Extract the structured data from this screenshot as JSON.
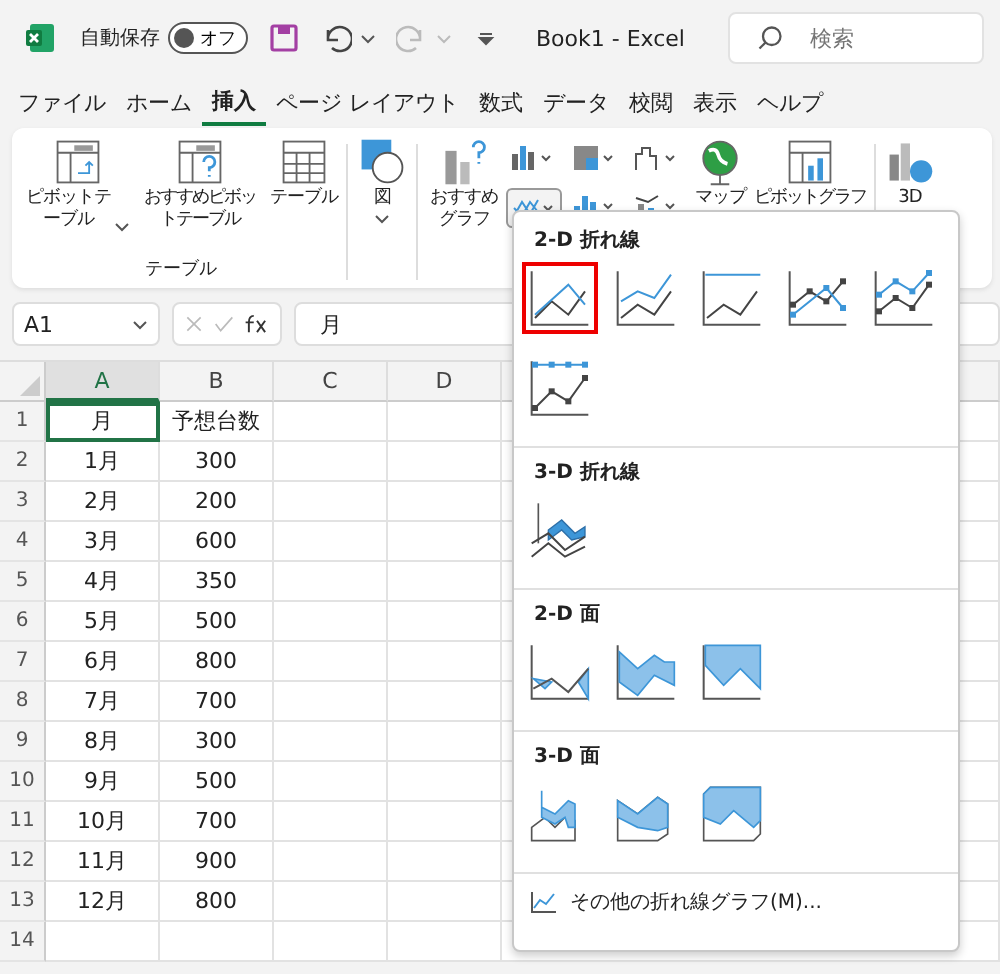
{
  "title_bar": {
    "autosave_label": "自動保存",
    "autosave_toggle": {
      "label": "オフ",
      "on": false
    },
    "title": "Book1  -  Excel",
    "search": {
      "placeholder": "検索"
    }
  },
  "tabs": [
    {
      "label": "ファイル",
      "selected": false
    },
    {
      "label": "ホーム",
      "selected": false
    },
    {
      "label": "挿入",
      "selected": true
    },
    {
      "label": "ページ レイアウト",
      "selected": false
    },
    {
      "label": "数式",
      "selected": false
    },
    {
      "label": "データ",
      "selected": false
    },
    {
      "label": "校閲",
      "selected": false
    },
    {
      "label": "表示",
      "selected": false
    },
    {
      "label": "ヘルプ",
      "selected": false
    }
  ],
  "ribbon": {
    "table_group": {
      "buttons": [
        {
          "label": "ピボットテーブル",
          "has_dropdown": true
        },
        {
          "label": "おすすめピボットテーブル",
          "has_dropdown": false
        },
        {
          "label": "テーブル",
          "has_dropdown": false
        }
      ],
      "title": "テーブル"
    },
    "figure_button": {
      "label": "図"
    },
    "charts_group": {
      "recommended": "おすすめグラフ",
      "map": "マップ",
      "pivot_chart": "ピボットグラフ",
      "map_3d": "3D"
    }
  },
  "formula_bar": {
    "name_box": "A1",
    "formula": "月"
  },
  "sheet": {
    "columns": [
      {
        "label": "A",
        "selected": true
      },
      {
        "label": "B",
        "selected": false
      },
      {
        "label": "C",
        "selected": false
      },
      {
        "label": "D",
        "selected": false
      }
    ],
    "rows": [
      {
        "number": "1",
        "cells": [
          "月",
          "予想台数"
        ]
      },
      {
        "number": "2",
        "cells": [
          "1月",
          "300"
        ]
      },
      {
        "number": "3",
        "cells": [
          "2月",
          "200"
        ]
      },
      {
        "number": "4",
        "cells": [
          "3月",
          "600"
        ]
      },
      {
        "number": "5",
        "cells": [
          "4月",
          "350"
        ]
      },
      {
        "number": "6",
        "cells": [
          "5月",
          "500"
        ]
      },
      {
        "number": "7",
        "cells": [
          "6月",
          "800"
        ]
      },
      {
        "number": "8",
        "cells": [
          "7月",
          "700"
        ]
      },
      {
        "number": "9",
        "cells": [
          "8月",
          "300"
        ]
      },
      {
        "number": "10",
        "cells": [
          "9月",
          "500"
        ]
      },
      {
        "number": "11",
        "cells": [
          "10月",
          "700"
        ]
      },
      {
        "number": "12",
        "cells": [
          "11月",
          "900"
        ]
      },
      {
        "number": "13",
        "cells": [
          "12月",
          "800"
        ]
      },
      {
        "number": "14",
        "cells": [
          "",
          ""
        ]
      }
    ]
  },
  "chart_menu": {
    "sections": [
      {
        "title": "2-D 折れ線",
        "items": [
          {
            "kind": "line",
            "selected": true
          },
          {
            "kind": "stacked-line",
            "selected": false
          },
          {
            "kind": "line-100",
            "selected": false
          },
          {
            "kind": "line-markers",
            "selected": false
          },
          {
            "kind": "stacked-line-markers",
            "selected": false
          },
          {
            "kind": "line-100-markers",
            "selected": false
          }
        ]
      },
      {
        "title": "3-D 折れ線",
        "items": [
          {
            "kind": "line-3d",
            "selected": false
          }
        ]
      },
      {
        "title": "2-D 面",
        "items": [
          {
            "kind": "area",
            "selected": false
          },
          {
            "kind": "stacked-area",
            "selected": false
          },
          {
            "kind": "area-100",
            "selected": false
          }
        ]
      },
      {
        "title": "3-D 面",
        "items": [
          {
            "kind": "area-3d",
            "selected": false
          },
          {
            "kind": "stacked-area-3d",
            "selected": false
          },
          {
            "kind": "area-100-3d",
            "selected": false
          }
        ]
      }
    ],
    "more": "その他の折れ線グラフ(M)..."
  }
}
